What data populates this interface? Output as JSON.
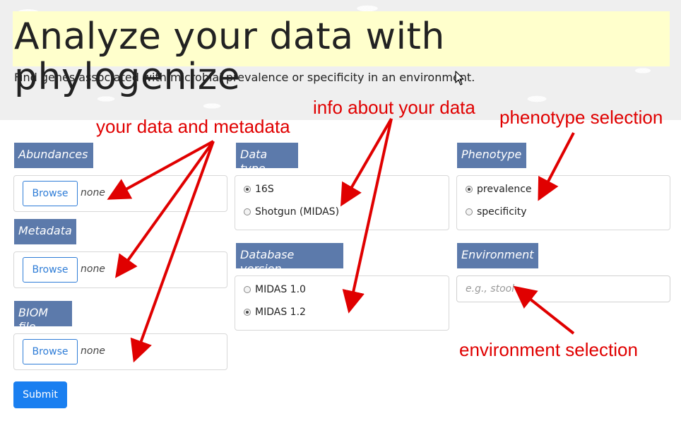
{
  "header": {
    "title": "Analyze your data with phylogenize",
    "subtitle": "Find genes associated with microbial prevalence or specificity in an environment."
  },
  "inputs": {
    "abundances": {
      "label": "Abundances",
      "button": "Browse",
      "file": "none"
    },
    "metadata": {
      "label": "Metadata",
      "button": "Browse",
      "file": "none"
    },
    "biom": {
      "label": "BIOM file",
      "button": "Browse",
      "file": "none"
    }
  },
  "data_type": {
    "label": "Data type",
    "options": [
      {
        "label": "16S",
        "checked": true
      },
      {
        "label": "Shotgun (MIDAS)",
        "checked": false
      }
    ]
  },
  "database_version": {
    "label": "Database version",
    "options": [
      {
        "label": "MIDAS 1.0",
        "checked": false
      },
      {
        "label": "MIDAS 1.2",
        "checked": true
      }
    ]
  },
  "phenotype": {
    "label": "Phenotype",
    "options": [
      {
        "label": "prevalence",
        "checked": true
      },
      {
        "label": "specificity",
        "checked": false
      }
    ]
  },
  "environment": {
    "label": "Environment",
    "placeholder": "e.g., stool",
    "value": ""
  },
  "submit": {
    "label": "Submit"
  },
  "annotations": {
    "data_metadata": "your data and metadata",
    "info": "info about your data",
    "phenotype": "phenotype selection",
    "environment": "environment selection"
  },
  "colors": {
    "label_bg": "#5c7aab",
    "title_bg": "#ffffcc",
    "primary": "#1a7ff0",
    "annotation": "#e00000"
  },
  "icons": [
    "mouse-cursor-icon",
    "radio-icon"
  ]
}
